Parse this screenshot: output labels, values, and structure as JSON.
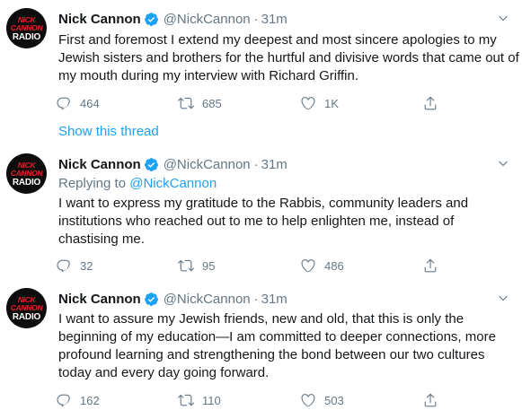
{
  "tweets": [
    {
      "avatar": {
        "line1": "NICK",
        "line2": "CANNON",
        "line3": "RADIO"
      },
      "name": "Nick Cannon",
      "handle": "@NickCannon",
      "dot": "·",
      "time": "31m",
      "reply_prefix": "",
      "reply_handle": "",
      "lines": [
        "First and foremost I extend my deepest and most sincere apologies to my",
        "Jewish sisters and brothers for the hurtful and divisive words that came out of",
        "my mouth during my interview with Richard Griffin."
      ],
      "replies": "464",
      "retweets": "685",
      "likes": "1K"
    },
    {
      "avatar": {
        "line1": "NICK",
        "line2": "CANNON",
        "line3": "RADIO"
      },
      "name": "Nick Cannon",
      "handle": "@NickCannon",
      "dot": "·",
      "time": "31m",
      "reply_prefix": "Replying to ",
      "reply_handle": "@NickCannon",
      "lines": [
        "I want to express my gratitude to the Rabbis, community leaders and",
        "institutions who reached out to me to help enlighten me, instead of",
        "chastising me."
      ],
      "replies": "32",
      "retweets": "95",
      "likes": "486"
    },
    {
      "avatar": {
        "line1": "NICK",
        "line2": "CANNON",
        "line3": "RADIO"
      },
      "name": "Nick Cannon",
      "handle": "@NickCannon",
      "dot": "·",
      "time": "31m",
      "reply_prefix": "",
      "reply_handle": "",
      "lines": [
        "I want to assure my Jewish friends, new and old, that this is only the",
        "beginning of my education—I am committed to deeper connections, more",
        "profound learning and strengthening the bond between our two cultures",
        "today and every day going forward."
      ],
      "replies": "162",
      "retweets": "110",
      "likes": "503"
    }
  ],
  "show_thread": "Show this thread",
  "colors": {
    "accent": "#1da1f2",
    "secondary_text": "#657786",
    "text": "#14171a",
    "avatar_red": "#e0202a"
  },
  "icons": [
    "verified-badge-icon",
    "caret-down-icon",
    "reply-icon",
    "retweet-icon",
    "like-icon",
    "share-icon"
  ]
}
